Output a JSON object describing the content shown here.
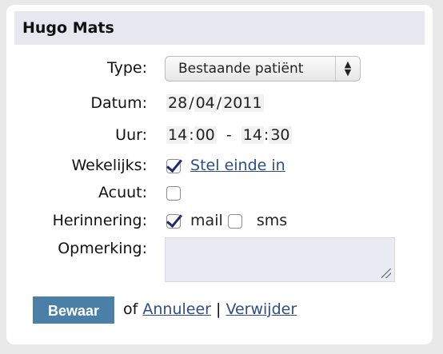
{
  "header": {
    "title": "Hugo Mats"
  },
  "form": {
    "type_label": "Type:",
    "type_value": "Bestaande patiënt",
    "date_label": "Datum:",
    "date_day": "28",
    "date_month": "04",
    "date_year": "2011",
    "date_sep": "/",
    "time_label": "Uur:",
    "start_hour": "14",
    "start_min": "00",
    "time_dash": "-",
    "end_hour": "14",
    "end_min": "30",
    "time_sep": ":",
    "weekly_label": "Wekelijks:",
    "weekly_checked": true,
    "weekly_link": "Stel einde in",
    "acute_label": "Acuut:",
    "acute_checked": false,
    "reminder_label": "Herinnering:",
    "reminder_mail_checked": true,
    "reminder_mail_label": "mail",
    "reminder_sms_checked": false,
    "reminder_sms_label": "sms",
    "remark_label": "Opmerking:",
    "remark_value": ""
  },
  "actions": {
    "save_label": "Bewaar",
    "of_text": "of",
    "cancel_label": "Annuleer",
    "separator": "|",
    "delete_label": "Verwijder"
  },
  "colors": {
    "header_bg": "#e6e7ef",
    "save_button": "#4a7fa8",
    "link": "#2c4f8a"
  }
}
